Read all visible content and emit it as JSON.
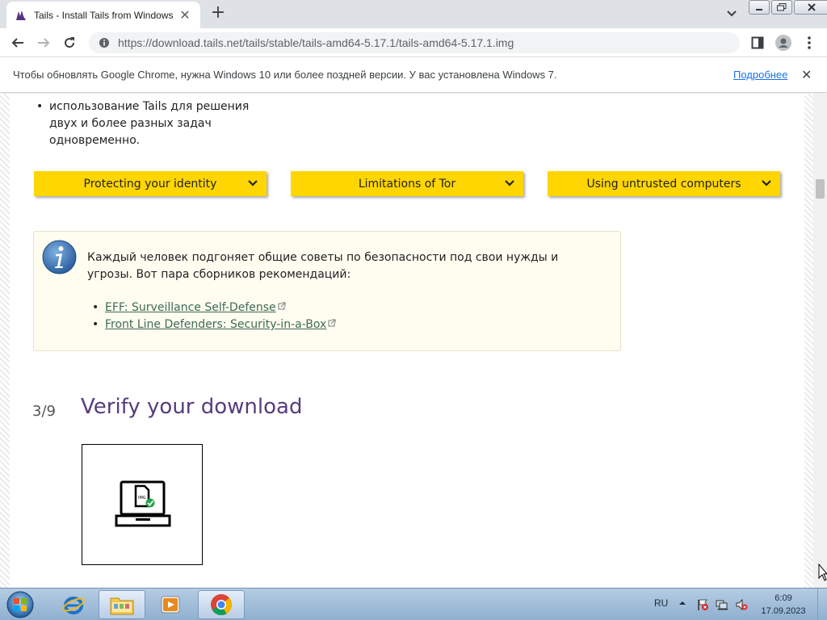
{
  "browser": {
    "tab": {
      "title": "Tails - Install Tails from Windows"
    },
    "url": "https://download.tails.net/tails/stable/tails-amd64-5.17.1/tails-amd64-5.17.1.img"
  },
  "infobar": {
    "message": "Чтобы обновлять Google Chrome, нужна Windows 10 или более поздней версии. У вас установлена Windows 7.",
    "link": "Подробнее"
  },
  "page": {
    "bullets": [
      "использование Tails для решения двух и более разных задач одновременно."
    ],
    "yellow_buttons": [
      "Protecting your identity",
      "Limitations of Tor",
      "Using untrusted computers"
    ],
    "note": {
      "text": "Каждый человек подгоняет общие советы по безопасности под свои нужды и угрозы. Вот пара сборников рекомендаций:",
      "links": [
        "EFF: Surveillance Self-Defense",
        "Front Line Defenders: Security-in-a-Box"
      ]
    },
    "step": {
      "number": "3/9",
      "title": "Verify your download"
    }
  },
  "taskbar": {
    "language": "RU",
    "time": "6:09",
    "date": "17.09.2023"
  },
  "colors": {
    "button_yellow": "#ffd600",
    "heading_purple": "#563d7c",
    "link_green": "#3f6a54"
  }
}
